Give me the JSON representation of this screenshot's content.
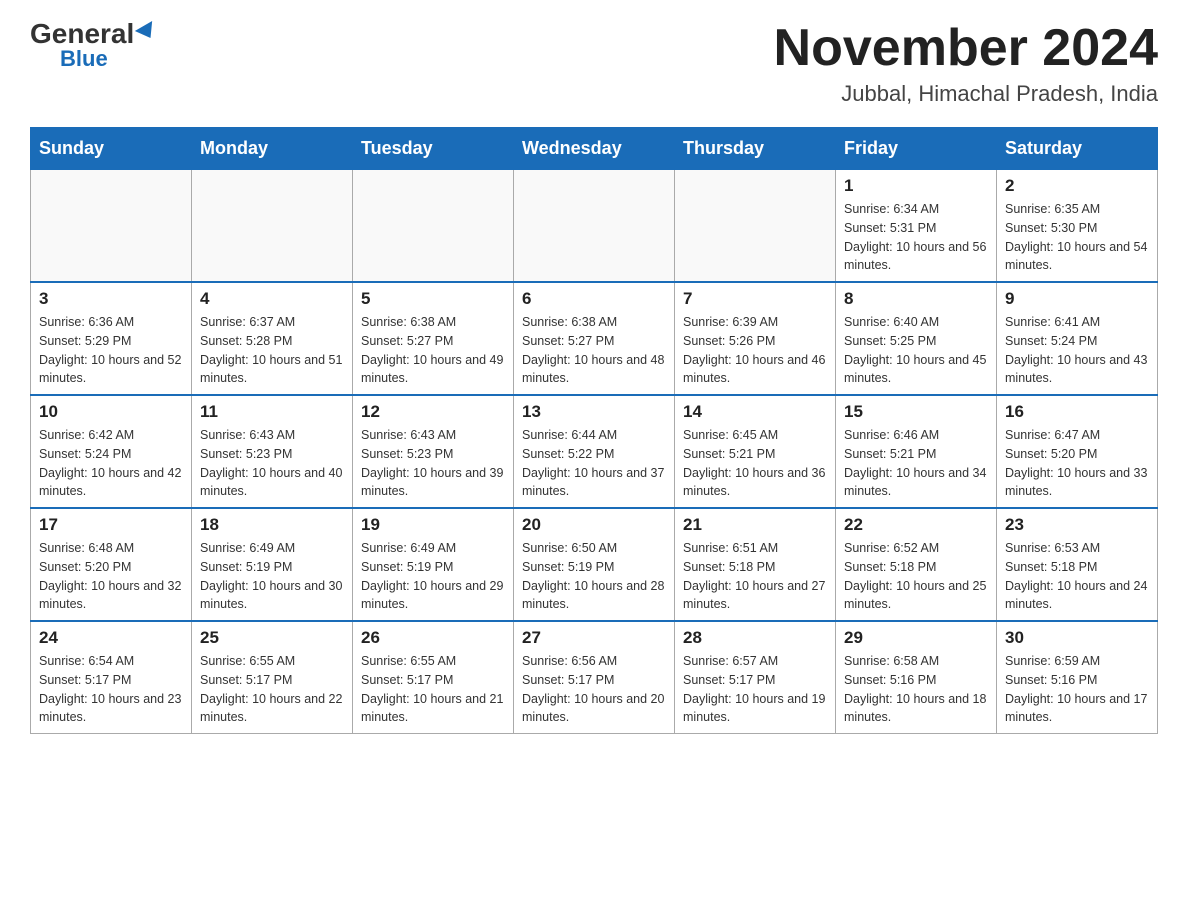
{
  "header": {
    "logo_general": "General",
    "logo_blue": "Blue",
    "month_title": "November 2024",
    "location": "Jubbal, Himachal Pradesh, India"
  },
  "days_of_week": [
    "Sunday",
    "Monday",
    "Tuesday",
    "Wednesday",
    "Thursday",
    "Friday",
    "Saturday"
  ],
  "weeks": [
    [
      {
        "day": "",
        "sunrise": "",
        "sunset": "",
        "daylight": ""
      },
      {
        "day": "",
        "sunrise": "",
        "sunset": "",
        "daylight": ""
      },
      {
        "day": "",
        "sunrise": "",
        "sunset": "",
        "daylight": ""
      },
      {
        "day": "",
        "sunrise": "",
        "sunset": "",
        "daylight": ""
      },
      {
        "day": "",
        "sunrise": "",
        "sunset": "",
        "daylight": ""
      },
      {
        "day": "1",
        "sunrise": "Sunrise: 6:34 AM",
        "sunset": "Sunset: 5:31 PM",
        "daylight": "Daylight: 10 hours and 56 minutes."
      },
      {
        "day": "2",
        "sunrise": "Sunrise: 6:35 AM",
        "sunset": "Sunset: 5:30 PM",
        "daylight": "Daylight: 10 hours and 54 minutes."
      }
    ],
    [
      {
        "day": "3",
        "sunrise": "Sunrise: 6:36 AM",
        "sunset": "Sunset: 5:29 PM",
        "daylight": "Daylight: 10 hours and 52 minutes."
      },
      {
        "day": "4",
        "sunrise": "Sunrise: 6:37 AM",
        "sunset": "Sunset: 5:28 PM",
        "daylight": "Daylight: 10 hours and 51 minutes."
      },
      {
        "day": "5",
        "sunrise": "Sunrise: 6:38 AM",
        "sunset": "Sunset: 5:27 PM",
        "daylight": "Daylight: 10 hours and 49 minutes."
      },
      {
        "day": "6",
        "sunrise": "Sunrise: 6:38 AM",
        "sunset": "Sunset: 5:27 PM",
        "daylight": "Daylight: 10 hours and 48 minutes."
      },
      {
        "day": "7",
        "sunrise": "Sunrise: 6:39 AM",
        "sunset": "Sunset: 5:26 PM",
        "daylight": "Daylight: 10 hours and 46 minutes."
      },
      {
        "day": "8",
        "sunrise": "Sunrise: 6:40 AM",
        "sunset": "Sunset: 5:25 PM",
        "daylight": "Daylight: 10 hours and 45 minutes."
      },
      {
        "day": "9",
        "sunrise": "Sunrise: 6:41 AM",
        "sunset": "Sunset: 5:24 PM",
        "daylight": "Daylight: 10 hours and 43 minutes."
      }
    ],
    [
      {
        "day": "10",
        "sunrise": "Sunrise: 6:42 AM",
        "sunset": "Sunset: 5:24 PM",
        "daylight": "Daylight: 10 hours and 42 minutes."
      },
      {
        "day": "11",
        "sunrise": "Sunrise: 6:43 AM",
        "sunset": "Sunset: 5:23 PM",
        "daylight": "Daylight: 10 hours and 40 minutes."
      },
      {
        "day": "12",
        "sunrise": "Sunrise: 6:43 AM",
        "sunset": "Sunset: 5:23 PM",
        "daylight": "Daylight: 10 hours and 39 minutes."
      },
      {
        "day": "13",
        "sunrise": "Sunrise: 6:44 AM",
        "sunset": "Sunset: 5:22 PM",
        "daylight": "Daylight: 10 hours and 37 minutes."
      },
      {
        "day": "14",
        "sunrise": "Sunrise: 6:45 AM",
        "sunset": "Sunset: 5:21 PM",
        "daylight": "Daylight: 10 hours and 36 minutes."
      },
      {
        "day": "15",
        "sunrise": "Sunrise: 6:46 AM",
        "sunset": "Sunset: 5:21 PM",
        "daylight": "Daylight: 10 hours and 34 minutes."
      },
      {
        "day": "16",
        "sunrise": "Sunrise: 6:47 AM",
        "sunset": "Sunset: 5:20 PM",
        "daylight": "Daylight: 10 hours and 33 minutes."
      }
    ],
    [
      {
        "day": "17",
        "sunrise": "Sunrise: 6:48 AM",
        "sunset": "Sunset: 5:20 PM",
        "daylight": "Daylight: 10 hours and 32 minutes."
      },
      {
        "day": "18",
        "sunrise": "Sunrise: 6:49 AM",
        "sunset": "Sunset: 5:19 PM",
        "daylight": "Daylight: 10 hours and 30 minutes."
      },
      {
        "day": "19",
        "sunrise": "Sunrise: 6:49 AM",
        "sunset": "Sunset: 5:19 PM",
        "daylight": "Daylight: 10 hours and 29 minutes."
      },
      {
        "day": "20",
        "sunrise": "Sunrise: 6:50 AM",
        "sunset": "Sunset: 5:19 PM",
        "daylight": "Daylight: 10 hours and 28 minutes."
      },
      {
        "day": "21",
        "sunrise": "Sunrise: 6:51 AM",
        "sunset": "Sunset: 5:18 PM",
        "daylight": "Daylight: 10 hours and 27 minutes."
      },
      {
        "day": "22",
        "sunrise": "Sunrise: 6:52 AM",
        "sunset": "Sunset: 5:18 PM",
        "daylight": "Daylight: 10 hours and 25 minutes."
      },
      {
        "day": "23",
        "sunrise": "Sunrise: 6:53 AM",
        "sunset": "Sunset: 5:18 PM",
        "daylight": "Daylight: 10 hours and 24 minutes."
      }
    ],
    [
      {
        "day": "24",
        "sunrise": "Sunrise: 6:54 AM",
        "sunset": "Sunset: 5:17 PM",
        "daylight": "Daylight: 10 hours and 23 minutes."
      },
      {
        "day": "25",
        "sunrise": "Sunrise: 6:55 AM",
        "sunset": "Sunset: 5:17 PM",
        "daylight": "Daylight: 10 hours and 22 minutes."
      },
      {
        "day": "26",
        "sunrise": "Sunrise: 6:55 AM",
        "sunset": "Sunset: 5:17 PM",
        "daylight": "Daylight: 10 hours and 21 minutes."
      },
      {
        "day": "27",
        "sunrise": "Sunrise: 6:56 AM",
        "sunset": "Sunset: 5:17 PM",
        "daylight": "Daylight: 10 hours and 20 minutes."
      },
      {
        "day": "28",
        "sunrise": "Sunrise: 6:57 AM",
        "sunset": "Sunset: 5:17 PM",
        "daylight": "Daylight: 10 hours and 19 minutes."
      },
      {
        "day": "29",
        "sunrise": "Sunrise: 6:58 AM",
        "sunset": "Sunset: 5:16 PM",
        "daylight": "Daylight: 10 hours and 18 minutes."
      },
      {
        "day": "30",
        "sunrise": "Sunrise: 6:59 AM",
        "sunset": "Sunset: 5:16 PM",
        "daylight": "Daylight: 10 hours and 17 minutes."
      }
    ]
  ]
}
